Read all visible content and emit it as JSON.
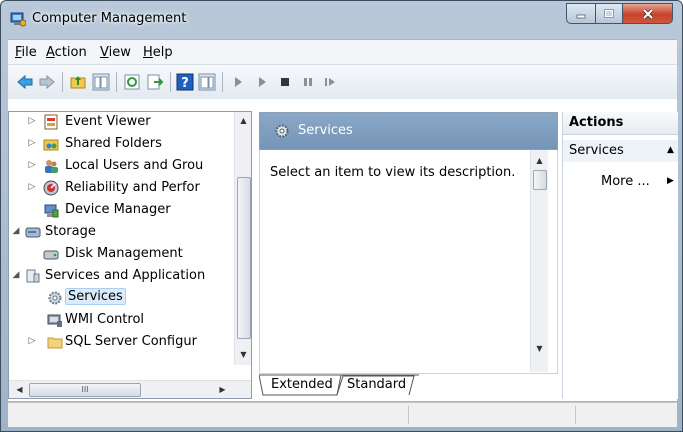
{
  "window": {
    "title": "Computer Management"
  },
  "menu": [
    {
      "label": "File",
      "key": "F",
      "rest": "ile"
    },
    {
      "label": "Action",
      "key": "A",
      "rest": "ction"
    },
    {
      "label": "View",
      "key": "V",
      "rest": "iew"
    },
    {
      "label": "Help",
      "key": "H",
      "rest": "elp"
    }
  ],
  "toolbar": {
    "buttons": [
      "back-icon",
      "forward-icon",
      "up-folder-icon",
      "show-hide-tree-icon",
      "refresh-icon",
      "export-list-icon",
      "help-icon",
      "show-hide-action-pane-icon",
      "start-service-icon",
      "start-service-alt-icon",
      "stop-service-icon",
      "pause-service-icon",
      "resume-service-icon"
    ]
  },
  "tree": {
    "items": [
      {
        "label": "Event Viewer",
        "icon": "event-viewer-icon",
        "expander": "collapsed"
      },
      {
        "label": "Shared Folders",
        "icon": "shared-folders-icon",
        "expander": "collapsed"
      },
      {
        "label": "Local Users and Grou",
        "icon": "local-users-icon",
        "expander": "collapsed"
      },
      {
        "label": "Reliability and Perfor",
        "icon": "reliability-icon",
        "expander": "collapsed"
      },
      {
        "label": "Device Manager",
        "icon": "device-manager-icon",
        "expander": "none"
      },
      {
        "label": "Storage",
        "icon": "storage-icon",
        "expander": "expanded"
      },
      {
        "label": "Disk Management",
        "icon": "disk-management-icon",
        "expander": "none"
      },
      {
        "label": "Services and Application",
        "icon": "services-apps-icon",
        "expander": "expanded"
      },
      {
        "label": "Services",
        "icon": "services-gear-icon",
        "expander": "none",
        "selected": true
      },
      {
        "label": "WMI Control",
        "icon": "wmi-control-icon",
        "expander": "none"
      },
      {
        "label": "SQL Server Configur",
        "icon": "folder-icon",
        "expander": "collapsed"
      }
    ],
    "hscroll_grip": "III"
  },
  "center": {
    "header": "Services",
    "description": "Select an item to view its description.",
    "tabs": [
      "Extended",
      "Standard"
    ]
  },
  "actions": {
    "title": "Actions",
    "group": "Services",
    "more": "More ..."
  },
  "colors": {
    "header_blue": "#7f9fc0",
    "selection": "#dcebfc",
    "close_red": "#c7432b"
  }
}
